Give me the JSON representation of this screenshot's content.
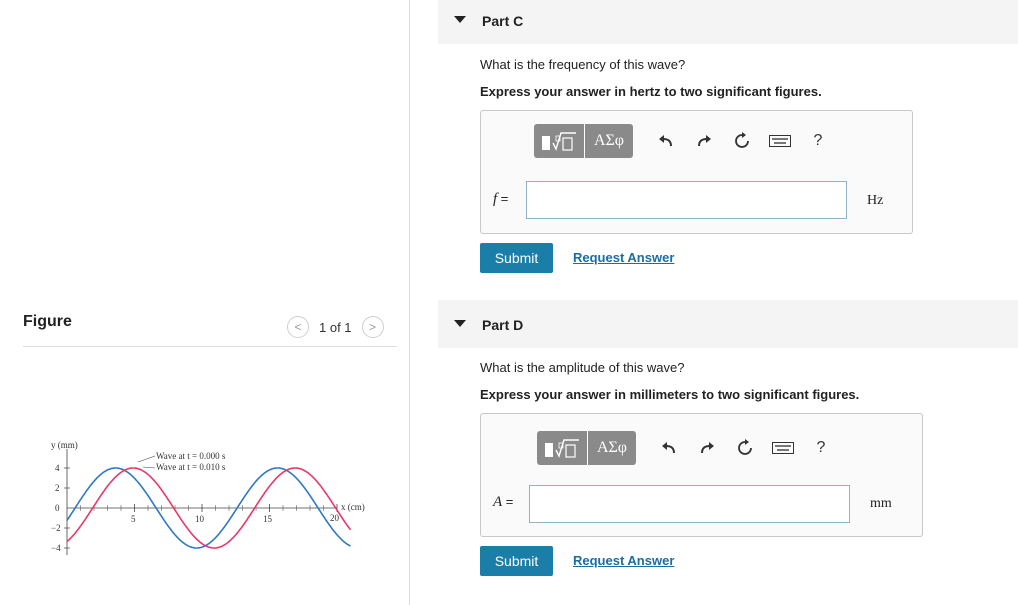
{
  "figure": {
    "title": "Figure",
    "pager_text": "1 of 1",
    "graph": {
      "y_label": "y (mm)",
      "x_label": "x (cm)",
      "y_ticks": [
        "4",
        "2",
        "0",
        "−2",
        "−4"
      ],
      "x_ticks": [
        "5",
        "10",
        "15",
        "20"
      ],
      "legend": [
        "Wave at t = 0.000 s",
        "Wave at t = 0.010 s"
      ],
      "series_colors": [
        "#2f78c4",
        "#e8386a"
      ]
    }
  },
  "partC": {
    "title": "Part C",
    "question": "What is the frequency of this wave?",
    "instruction": "Express your answer in hertz to two significant figures.",
    "var_label": "f",
    "var_eq": " =",
    "value": "",
    "unit": "Hz",
    "submit": "Submit",
    "request": "Request Answer"
  },
  "partD": {
    "title": "Part D",
    "question": "What is the amplitude of this wave?",
    "instruction": "Express your answer in millimeters to two significant figures.",
    "var_label": "A",
    "var_eq": " =",
    "value": "",
    "unit": "mm",
    "submit": "Submit",
    "request": "Request Answer"
  },
  "toolbar": {
    "greek_label": "ΑΣφ",
    "help_label": "?",
    "icons": [
      "templates-icon",
      "greek-symbols-icon",
      "undo-icon",
      "redo-icon",
      "reset-icon",
      "keyboard-icon",
      "help-icon"
    ]
  },
  "pager": {
    "prev": "<",
    "next": ">"
  }
}
